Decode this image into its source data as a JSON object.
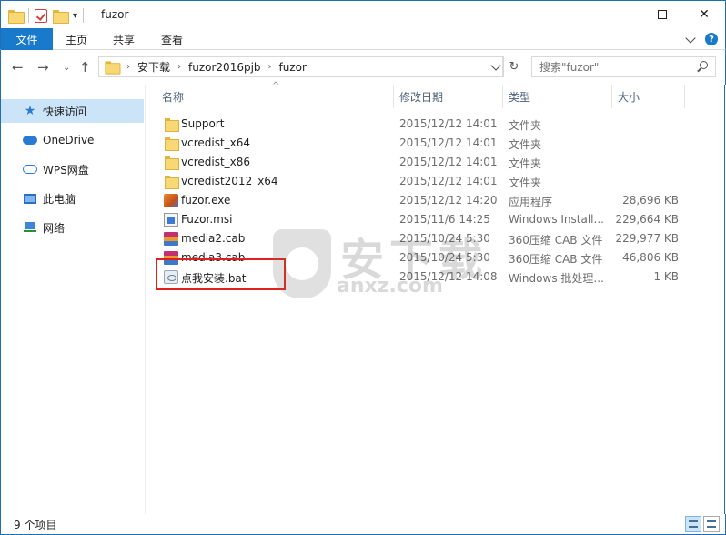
{
  "window": {
    "title": "fuzor",
    "quick_access_dropdown": "▾"
  },
  "ribbon": {
    "tabs": [
      "文件",
      "主页",
      "共享",
      "查看"
    ]
  },
  "address": {
    "breadcrumbs": [
      "安下载",
      "fuzor2016pjb",
      "fuzor"
    ],
    "search_placeholder": "搜索\"fuzor\""
  },
  "sidebar": {
    "items": [
      {
        "label": "快速访问",
        "icon": "star-icon",
        "active": true
      },
      {
        "label": "OneDrive",
        "icon": "onedrive-cloud-icon"
      },
      {
        "label": "WPS网盘",
        "icon": "wps-cloud-icon"
      },
      {
        "label": "此电脑",
        "icon": "computer-icon"
      },
      {
        "label": "网络",
        "icon": "network-icon"
      }
    ]
  },
  "columns": {
    "name": "名称",
    "date": "修改日期",
    "type": "类型",
    "size": "大小"
  },
  "files": [
    {
      "name": "Support",
      "date": "2015/12/12 14:01",
      "type": "文件夹",
      "size": "",
      "icon": "folder-icon"
    },
    {
      "name": "vcredist_x64",
      "date": "2015/12/12 14:01",
      "type": "文件夹",
      "size": "",
      "icon": "folder-icon"
    },
    {
      "name": "vcredist_x86",
      "date": "2015/12/12 14:01",
      "type": "文件夹",
      "size": "",
      "icon": "folder-icon"
    },
    {
      "name": "vcredist2012_x64",
      "date": "2015/12/12 14:01",
      "type": "文件夹",
      "size": "",
      "icon": "folder-icon"
    },
    {
      "name": "fuzor.exe",
      "date": "2015/12/12 14:20",
      "type": "应用程序",
      "size": "28,696 KB",
      "icon": "exe-icon"
    },
    {
      "name": "Fuzor.msi",
      "date": "2015/11/6 14:25",
      "type": "Windows Install...",
      "size": "229,664 KB",
      "icon": "msi-icon"
    },
    {
      "name": "media2.cab",
      "date": "2015/10/24 5:30",
      "type": "360压缩 CAB 文件",
      "size": "229,977 KB",
      "icon": "cab-icon"
    },
    {
      "name": "media3.cab",
      "date": "2015/10/24 5:30",
      "type": "360压缩 CAB 文件",
      "size": "46,806 KB",
      "icon": "cab-icon"
    },
    {
      "name": "点我安装.bat",
      "date": "2015/12/12 14:08",
      "type": "Windows 批处理...",
      "size": "1 KB",
      "icon": "bat-icon"
    }
  ],
  "status": {
    "item_count": "9 个项目"
  },
  "watermark": {
    "text": "安下载",
    "sub": "anxz.com"
  }
}
